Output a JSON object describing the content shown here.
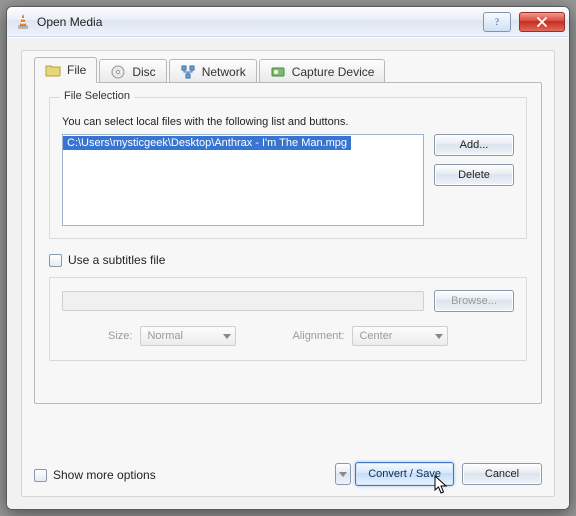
{
  "window": {
    "title": "Open Media"
  },
  "tabs": {
    "file": "File",
    "disc": "Disc",
    "network": "Network",
    "capture": "Capture Device"
  },
  "file_selection": {
    "group_label": "File Selection",
    "hint": "You can select local files with the following list and buttons.",
    "selected_path": "C:\\Users\\mysticgeek\\Desktop\\Anthrax - I'm The Man.mpg",
    "add_label": "Add...",
    "delete_label": "Delete"
  },
  "subtitles": {
    "use_label": "Use a subtitles file",
    "browse_label": "Browse...",
    "size_label": "Size:",
    "size_value": "Normal",
    "align_label": "Alignment:",
    "align_value": "Center"
  },
  "footer": {
    "show_more": "Show more options",
    "convert": "Convert / Save",
    "cancel": "Cancel"
  }
}
